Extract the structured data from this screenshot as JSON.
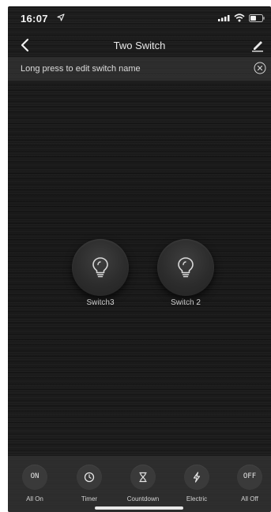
{
  "status_bar": {
    "time": "16:07",
    "icons": [
      "location-arrow-icon",
      "signal-icon",
      "wifi-icon",
      "battery-icon"
    ]
  },
  "nav": {
    "title": "Two Switch",
    "back_icon": "chevron-left-icon",
    "edit_icon": "pencil-icon"
  },
  "hint": {
    "text": "Long press to edit switch name",
    "close_icon": "close-circle-icon"
  },
  "switches": [
    {
      "label": "Switch3",
      "icon": "lightbulb-icon"
    },
    {
      "label": "Switch 2",
      "icon": "lightbulb-icon"
    }
  ],
  "actions": [
    {
      "icon_text": "ON",
      "label": "All On"
    },
    {
      "icon": "clock-icon",
      "label": "Timer"
    },
    {
      "icon": "hourglass-icon",
      "label": "Countdown"
    },
    {
      "icon": "lightning-icon",
      "label": "Electric"
    },
    {
      "icon_text": "OFF",
      "label": "All Off"
    }
  ],
  "colors": {
    "background": "#1a1a1a",
    "bottom_bar": "#303030",
    "text": "#e6e6e6"
  }
}
